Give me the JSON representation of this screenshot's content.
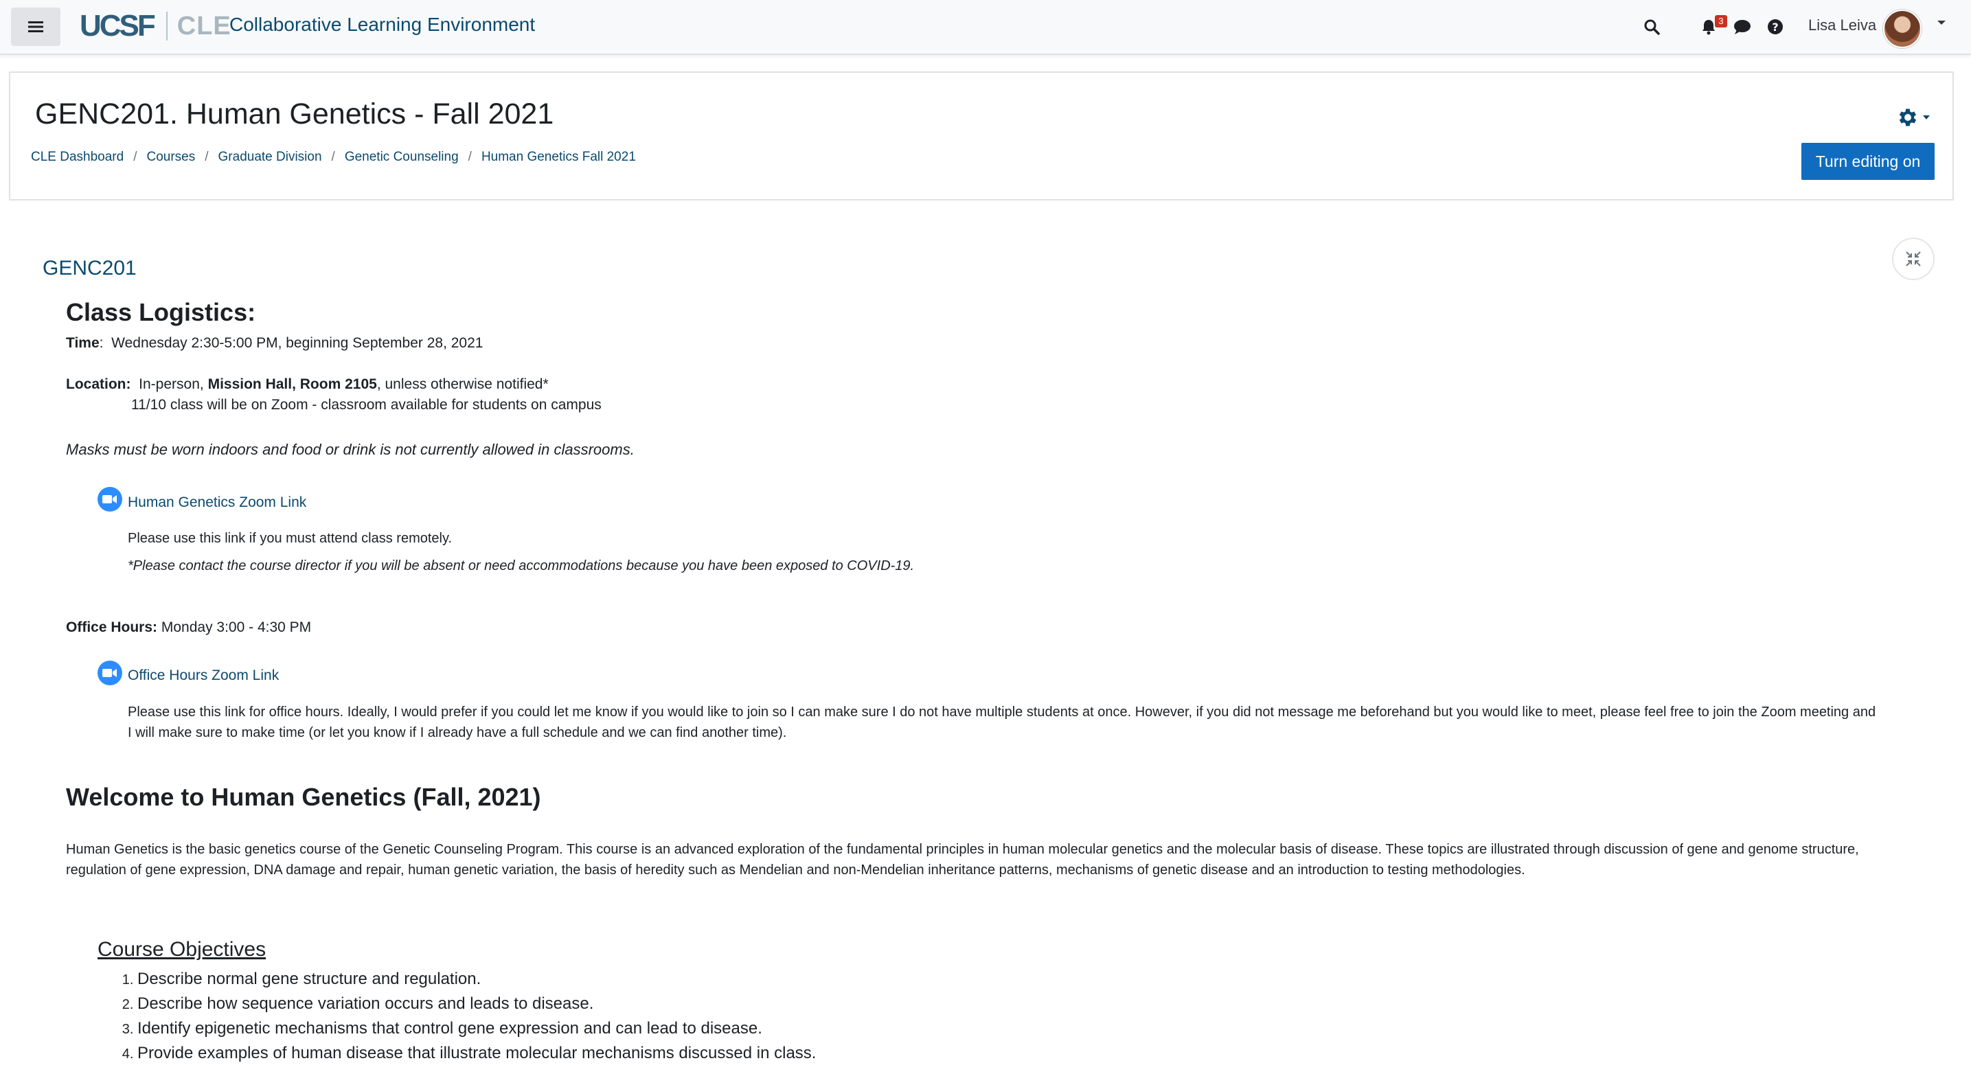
{
  "navbar": {
    "menu_icon": "hamburger-icon",
    "logo_ucsf": "UCSF",
    "logo_cle": "CLE",
    "site_name": "Collaborative Learning Environment",
    "search_icon": "search-icon",
    "notifications_icon": "bell-icon",
    "notification_count": "3",
    "messages_icon": "chat-bubble-icon",
    "help_icon": "question-circle-icon",
    "user_name": "Lisa Leiva",
    "avatar_icon": "avatar-photo",
    "user_menu_icon": "caret-down-icon"
  },
  "header": {
    "title": "GENC201. Human Genetics - Fall 2021",
    "breadcrumbs": [
      "CLE Dashboard",
      "Courses",
      "Graduate Division",
      "Genetic Counseling",
      "Human Genetics Fall 2021"
    ],
    "settings_icon": "gear-icon",
    "edit_button": "Turn editing on"
  },
  "section": {
    "title": "GENC201",
    "collapse_icon": "collapse-all-icon"
  },
  "logistics": {
    "heading": "Class Logistics:",
    "time_label": "Time",
    "time_value": "Wednesday 2:30-5:00 PM, beginning September 28, 2021",
    "location_label": "Location:",
    "location_prefix": "In-person,",
    "location_room": "Mission Hall, Room 2105",
    "location_suffix": ", unless otherwise notified*",
    "location_note": "11/10 class will be on Zoom - classroom available for students on campus",
    "masks_note": "Masks must be worn indoors and food or drink is not currently allowed in classrooms.",
    "zoom_link": "Human Genetics Zoom Link",
    "zoom_desc": "Please use this link if you must attend class remotely.",
    "zoom_note": "*Please contact the course director if you will be absent or need accommodations because you have been exposed to COVID-19.",
    "office_label": "Office Hours:",
    "office_value": "Monday 3:00 - 4:30 PM",
    "office_link": "Office Hours Zoom Link",
    "office_desc": "Please use this link for office hours. Ideally, I would prefer if you could let me know if you would like to join so I can make sure I do not have multiple students at once. However, if you did not message me beforehand but you would like to meet, please feel free to join the Zoom meeting and I will make sure to make time (or let you know if I already have a full schedule and we can find another time)."
  },
  "welcome": {
    "heading": "Welcome to Human Genetics (Fall, 2021)",
    "body": "Human Genetics is the basic genetics course of the Genetic Counseling Program.  This course is an advanced exploration of the fundamental principles in human molecular genetics and the molecular basis of disease.  These topics are illustrated through discussion of gene and genome structure, regulation of gene expression, DNA damage and repair, human genetic variation, the basis of heredity such as Mendelian and non-Mendelian inheritance patterns, mechanisms of genetic disease and an introduction to testing methodologies."
  },
  "objectives": {
    "title": "Course Objectives",
    "items": [
      "Describe normal gene structure and regulation.",
      "Describe how sequence variation occurs and leads to disease.",
      "Identify epigenetic mechanisms that control gene expression and can lead to disease.",
      "Provide examples of human disease that illustrate molecular mechanisms discussed in class."
    ]
  },
  "colors": {
    "primary": "#0f6cbf",
    "link": "#0b4a6e",
    "zoom": "#2d8cff",
    "badge": "#ca3120"
  }
}
